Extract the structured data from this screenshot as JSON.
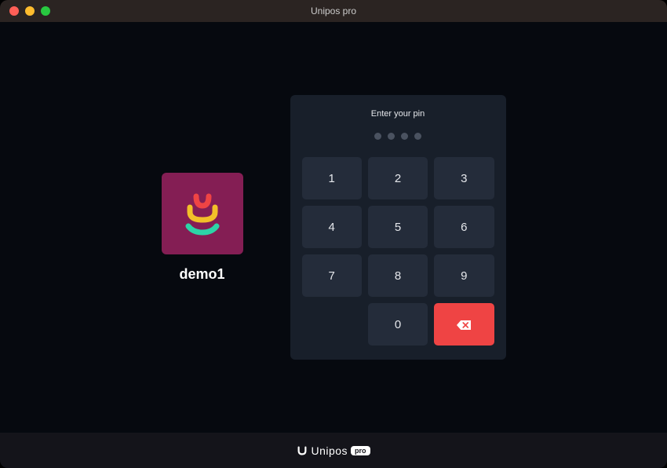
{
  "window": {
    "title": "Unipos pro"
  },
  "user": {
    "name": "demo1"
  },
  "pin": {
    "prompt": "Enter your pin",
    "length": 4,
    "keys": [
      "1",
      "2",
      "3",
      "4",
      "5",
      "6",
      "7",
      "8",
      "9",
      "",
      "0"
    ]
  },
  "footer": {
    "brand": "Unipos",
    "badge": "pro"
  },
  "colors": {
    "avatar_bg": "#841e54",
    "delete_bg": "#ef4444",
    "panel_bg": "#181f2a",
    "key_bg": "#242c3a"
  }
}
